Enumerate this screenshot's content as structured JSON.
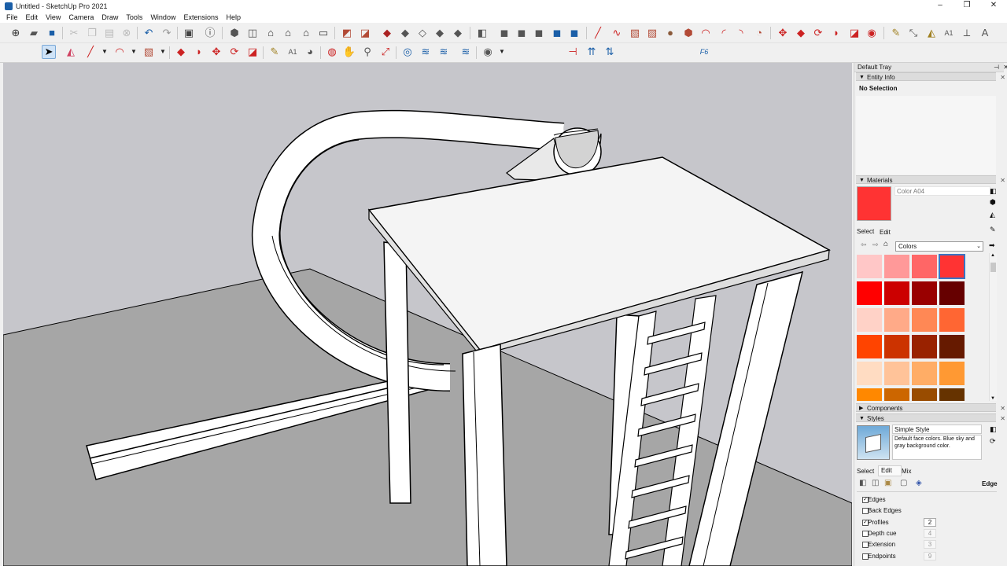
{
  "window": {
    "title": "Untitled - SketchUp Pro 2021",
    "controls": [
      "–",
      "❐",
      "✕"
    ]
  },
  "menu": [
    "File",
    "Edit",
    "View",
    "Camera",
    "Draw",
    "Tools",
    "Window",
    "Extensions",
    "Help"
  ],
  "viewport": {
    "sky_color": "#c6c6cb",
    "ground_color": "#a6a6a6",
    "face_color": "#ffffff",
    "edge_color": "#000000"
  },
  "tray": {
    "title": "Default Tray",
    "entity_info": {
      "header": "Entity Info",
      "value": "No Selection"
    },
    "materials": {
      "header": "Materials",
      "current_name": "Color A04",
      "current_color": "#ff3333",
      "tabs": [
        "Select",
        "Edit"
      ],
      "library": "Colors",
      "swatches": [
        "#ffc7c7",
        "#ff9999",
        "#ff6666",
        "#ff3333",
        "#ff0000",
        "#cc0000",
        "#990000",
        "#660000",
        "#ffd2c7",
        "#ffaa88",
        "#ff8855",
        "#ff6633",
        "#ff4400",
        "#cc3300",
        "#992200",
        "#661a00",
        "#ffdcc2",
        "#ffc399",
        "#ffad66",
        "#ff9933",
        "#ff8800",
        "#cc6600",
        "#994c00",
        "#663300"
      ],
      "selected_index": 3
    },
    "components": {
      "header": "Components"
    },
    "styles": {
      "header": "Styles",
      "name": "Simple Style",
      "description": "Default face colors. Blue sky and gray background color.",
      "tabs": [
        "Select",
        "Edit",
        "Mix"
      ],
      "edge_section_label": "Edge",
      "settings": [
        {
          "label": "Edges",
          "checked": true,
          "value": ""
        },
        {
          "label": "Back Edges",
          "checked": false,
          "value": ""
        },
        {
          "label": "Profiles",
          "checked": true,
          "value": "2"
        },
        {
          "label": "Depth cue",
          "checked": false,
          "value": "4"
        },
        {
          "label": "Extension",
          "checked": false,
          "value": "3"
        },
        {
          "label": "Endpoints",
          "checked": false,
          "value": "9"
        }
      ]
    }
  },
  "toolbar2": {
    "f6_label": "F6"
  }
}
